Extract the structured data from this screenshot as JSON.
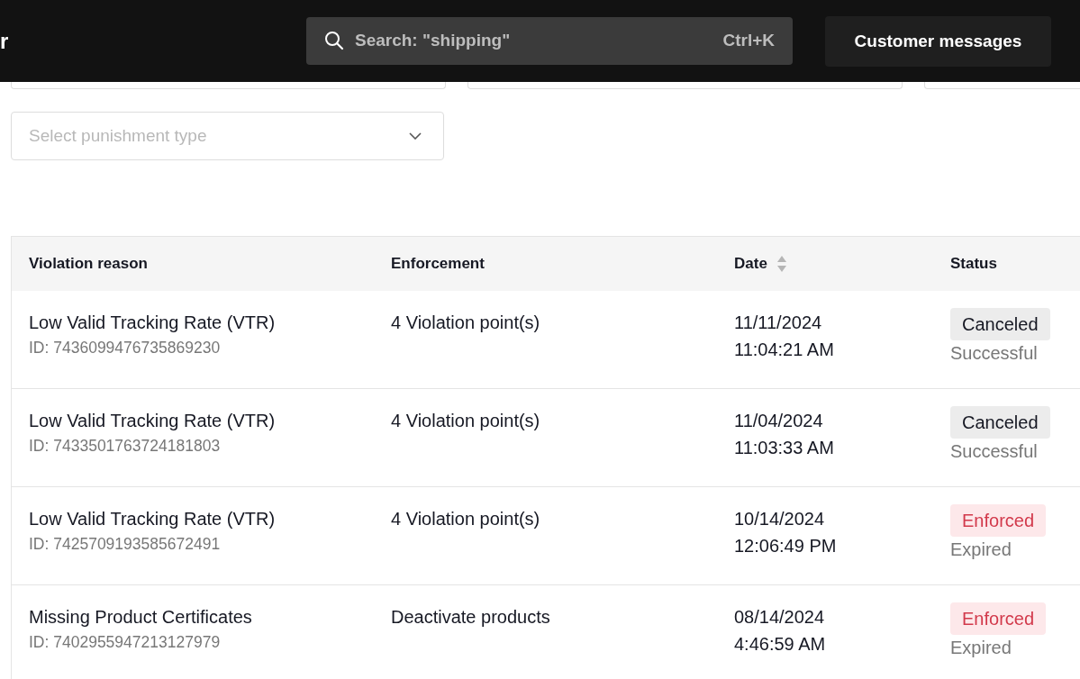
{
  "header": {
    "brand_fragment": "r",
    "search": {
      "placeholder": "Search: \"shipping\"",
      "shortcut": "Ctrl+K"
    },
    "button": "Customer messages"
  },
  "filters": {
    "punishment_select": {
      "placeholder": "Select punishment type"
    }
  },
  "table": {
    "columns": [
      {
        "label": "Violation reason",
        "sortable": false
      },
      {
        "label": "Enforcement",
        "sortable": false
      },
      {
        "label": "Date",
        "sortable": true
      },
      {
        "label": "Status",
        "sortable": false
      }
    ],
    "rows": [
      {
        "reason": "Low Valid Tracking Rate (VTR)",
        "id": "ID: 7436099476735869230",
        "enforcement": "4 Violation point(s)",
        "date": "11/11/2024",
        "time": "11:04:21 AM",
        "status": {
          "label": "Canceled",
          "kind": "canceled"
        },
        "result": "Successful"
      },
      {
        "reason": "Low Valid Tracking Rate (VTR)",
        "id": "ID: 7433501763724181803",
        "enforcement": "4 Violation point(s)",
        "date": "11/04/2024",
        "time": "11:03:33 AM",
        "status": {
          "label": "Canceled",
          "kind": "canceled"
        },
        "result": "Successful"
      },
      {
        "reason": "Low Valid Tracking Rate (VTR)",
        "id": "ID: 7425709193585672491",
        "enforcement": "4 Violation point(s)",
        "date": "10/14/2024",
        "time": "12:06:49 PM",
        "status": {
          "label": "Enforced",
          "kind": "enforced"
        },
        "result": "Expired"
      },
      {
        "reason": "Missing Product Certificates",
        "id": "ID: 7402955947213127979",
        "enforcement": "Deactivate products",
        "date": "08/14/2024",
        "time": "4:46:59 AM",
        "status": {
          "label": "Enforced",
          "kind": "enforced"
        },
        "result": "Expired"
      }
    ]
  }
}
